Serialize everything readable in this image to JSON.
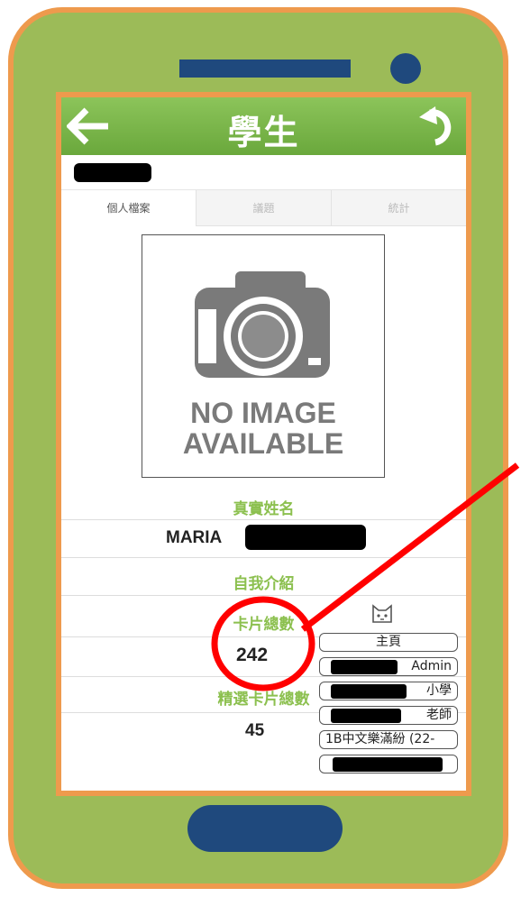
{
  "screen": {
    "title": "學生",
    "tabs": [
      {
        "label": "個人檔案",
        "active": true
      },
      {
        "label": "議題",
        "active": false
      },
      {
        "label": "統計",
        "active": false
      }
    ],
    "photo": {
      "line1": "NO IMAGE",
      "line2": "AVAILABLE"
    },
    "profile": {
      "real_name_label": "真實姓名",
      "real_name_value": "MARIA",
      "intro_label": "自我介紹",
      "card_total_label": "卡片總數",
      "card_total_value": "242",
      "featured_total_label": "精選卡片總數",
      "featured_total_value": "45"
    },
    "side_panel": {
      "icon": "cat-face-icon",
      "buttons": [
        {
          "label": "主頁"
        },
        {
          "label": "Admin"
        },
        {
          "label": "小學"
        },
        {
          "label": "老師"
        },
        {
          "label": "1B中文樂滿紛 (22-"
        },
        {
          "label": ""
        }
      ]
    }
  },
  "colors": {
    "phone_body": "#9cbb58",
    "phone_border": "#ee9a4d",
    "device_accent": "#1f497d",
    "titlebar_green": "#7ab648",
    "label_green": "#8cc04f",
    "annotation_red": "#ff0000"
  }
}
